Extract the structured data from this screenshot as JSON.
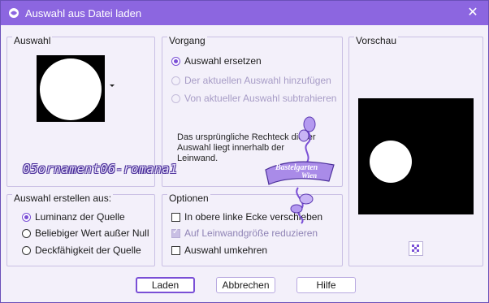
{
  "window": {
    "title": "Auswahl aus Datei laden",
    "close_glyph": "✕",
    "accent": "#8c66e0"
  },
  "auswahl": {
    "label": "Auswahl"
  },
  "vorgang": {
    "label": "Vorgang",
    "options": [
      {
        "label": "Auswahl ersetzen",
        "selected": true,
        "enabled": true
      },
      {
        "label": "Der aktuellen Auswahl hinzufügen",
        "selected": false,
        "enabled": false
      },
      {
        "label": "Von aktueller Auswahl subtrahieren",
        "selected": false,
        "enabled": false
      }
    ],
    "info_text": "Das ursprüngliche Rechteck dieser Auswahl liegt innerhalb der Leinwand."
  },
  "vorschau": {
    "label": "Vorschau"
  },
  "erstellen": {
    "label": "Auswahl erstellen aus:",
    "options": [
      {
        "label": "Luminanz der Quelle",
        "selected": true
      },
      {
        "label": "Beliebiger Wert außer Null",
        "selected": false
      },
      {
        "label": "Deckfähigkeit der Quelle",
        "selected": false
      }
    ]
  },
  "optionen": {
    "label": "Optionen",
    "checks": [
      {
        "label": "In obere linke Ecke verschieben",
        "checked": false,
        "enabled": true
      },
      {
        "label": "Auf Leinwandgröße reduzieren",
        "checked": true,
        "enabled": false
      },
      {
        "label": "Auswahl umkehren",
        "checked": false,
        "enabled": true
      }
    ]
  },
  "buttons": {
    "load": "Laden",
    "cancel": "Abbrechen",
    "help": "Hilfe"
  },
  "watermark": {
    "text": "05ornament06-romana1",
    "badge_line1": "Bastelgarten",
    "badge_line2": "Wien"
  }
}
